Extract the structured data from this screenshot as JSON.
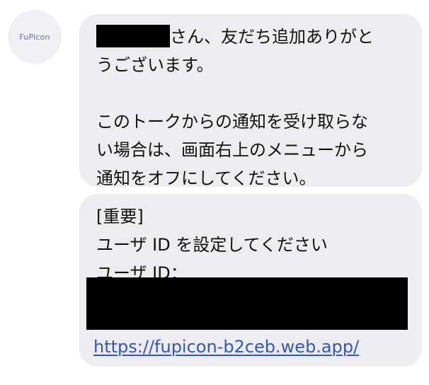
{
  "avatar": {
    "logo_text": "FuPicon"
  },
  "message1": {
    "line1_suffix": "さん、友だち追加ありがと",
    "line2": "うございます。",
    "line4": "このトークからの通知を受け取らな",
    "line5": "い場合は、画面右上のメニューから",
    "line6": "通知をオフにしてください。"
  },
  "message2": {
    "heading": "[重要]",
    "instruction": "ユーザ ID を設定してください",
    "id_label": "ユーザ ID：",
    "link": "https://fupicon-b2ceb.web.app/"
  }
}
